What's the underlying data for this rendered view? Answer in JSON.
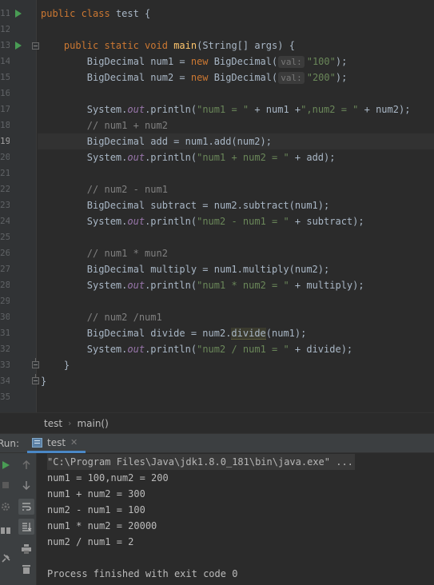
{
  "editor": {
    "line_numbers": [
      "11",
      "12",
      "13",
      "14",
      "15",
      "16",
      "17",
      "18",
      "19",
      "20",
      "21",
      "22",
      "23",
      "24",
      "25",
      "26",
      "27",
      "28",
      "29",
      "30",
      "31",
      "32",
      "33",
      "34",
      "35"
    ],
    "current_line": "19",
    "code": {
      "class_kw": "public class",
      "class_name": "test {",
      "method_kw": "public static void",
      "method_name": "main",
      "method_params": "(String[] args) {",
      "type": "BigDecimal",
      "num1_lhs": "BigDecimal num1 = ",
      "num2_lhs": "BigDecimal num2 = ",
      "new_kw": "new",
      "ctor": " BigDecimal(",
      "param_hint": "val:",
      "num1_val": "\"100\"",
      "num2_val": "\"200\"",
      "ctor_close": ");",
      "sys": "System.",
      "out": "out",
      "println_open": ".println(",
      "str_num1": "\"num1 = \"",
      "concat1": " + num1 +",
      "str_num2": "\",num2 = \"",
      "concat2": " + num2);",
      "cm_add": "// num1 + num2",
      "add_stmt": "BigDecimal add = num1.add(num2);",
      "str_add": "\"num1 + num2 = \"",
      "concat_add": " + add);",
      "cm_sub": "// num2 - num1",
      "sub_stmt": "BigDecimal subtract = num2.subtract(num1);",
      "str_sub": "\"num2 - num1 = \"",
      "concat_sub": " + subtract);",
      "cm_mul": "// num1 * mun2",
      "mul_stmt": "BigDecimal multiply = num1.multiply(num2);",
      "str_mul": "\"num1 * num2 = \"",
      "concat_mul": " + multiply);",
      "cm_div": "// num2 /num1",
      "div_lhs": "BigDecimal divide = num2.",
      "div_method": "divide",
      "div_rhs": "(num1);",
      "str_div": "\"num2 / num1 = \"",
      "concat_div": " + divide);",
      "close_method": "}",
      "close_class": "}"
    }
  },
  "breadcrumb": {
    "file": "test",
    "method": "main()"
  },
  "run_panel": {
    "label": "Run:",
    "tab": "test",
    "close": "✕",
    "output": [
      "\"C:\\Program Files\\Java\\jdk1.8.0_181\\bin\\java.exe\" ...",
      "num1 = 100,num2 = 200",
      "num1 + num2 = 300",
      "num2 - num1 = 100",
      "num1 * num2 = 20000",
      "num2 / num1 = 2",
      "",
      "Process finished with exit code 0"
    ]
  },
  "colors": {
    "background": "#2b2b2b",
    "keyword": "#cc7832",
    "string": "#6a8759",
    "method": "#ffc66d",
    "static_field": "#9876aa",
    "comment": "#808080",
    "run_green": "#499c54",
    "tab_accent": "#4a88c7"
  },
  "icons": [
    "run-icon",
    "fold-icon",
    "rerun-icon",
    "stop-icon",
    "up-arrow-icon",
    "down-arrow-icon",
    "soft-wrap-icon",
    "scroll-end-icon",
    "settings-icon",
    "layout-icon",
    "pin-icon",
    "print-icon",
    "trash-icon",
    "close-icon",
    "chevron-right-icon"
  ]
}
